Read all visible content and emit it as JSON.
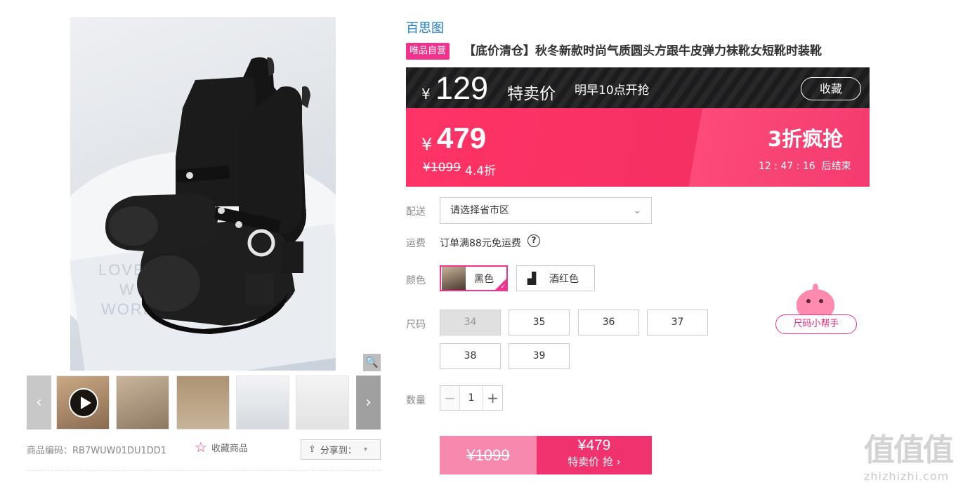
{
  "product": {
    "brand": "百思图",
    "tag": "唯品自营",
    "title": "【底价清仓】秋冬新款时尚气质圆头方跟牛皮弹力袜靴女短靴时装靴",
    "presale": {
      "currency": "¥",
      "price": "129",
      "label": "特卖价",
      "time": "明早10点开抢",
      "collect_label": "收藏"
    },
    "current": {
      "currency": "¥",
      "price": "479",
      "original": "¥1099",
      "discount": "4.4折",
      "promo": "3折疯抢",
      "countdown": "12 : 47 : 16  后结束"
    }
  },
  "options": {
    "delivery_label": "配送",
    "delivery_placeholder": "请选择省市区",
    "shipping_label": "运费",
    "shipping_text": "订单满88元免运费",
    "help_glyph": "?",
    "color_label": "颜色",
    "colors": [
      "黑色",
      "酒红色"
    ],
    "size_label": "尺码",
    "sizes": [
      "34",
      "35",
      "36",
      "37",
      "38",
      "39"
    ],
    "size_helper": "尺码小帮手",
    "qty_label": "数量",
    "qty_value": "1",
    "minus": "−",
    "plus": "+"
  },
  "buy": {
    "original": "¥1099",
    "price": "¥479",
    "label": "特卖价 抢 ›"
  },
  "gallery": {
    "sku": "商品编码：RB7WUW01DU1DD1",
    "favorite": "收藏商品",
    "share": "分享到：",
    "zoom_glyph": "🔍",
    "prev_glyph": "‹",
    "next_glyph": "›",
    "paper_text": [
      "LOVE",
      "W",
      "WORL"
    ]
  },
  "watermark": {
    "big": "值值值",
    "small": "zhizhizhi.com"
  },
  "colors": {
    "accent_pink": "#f0338c",
    "sale_pink": "#ff3366",
    "brand_blue": "#1f7ac8",
    "dark_bar": "#1c1c1e"
  }
}
